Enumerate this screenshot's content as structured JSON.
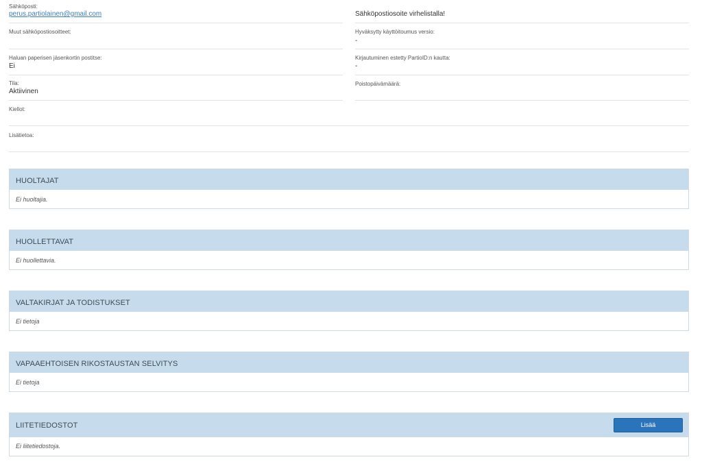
{
  "left_fields": [
    {
      "label": "Sähköposti:",
      "value": "perus.partiolainen@gmail.com"
    },
    {
      "label": "Muut sähköpostiosoitteet:",
      "value": ""
    },
    {
      "label": "Haluan paperisen jäsenkortin postitse:",
      "value": "Ei"
    },
    {
      "label": "Tila:",
      "value": "Aktiivinen"
    }
  ],
  "right_fields": [
    {
      "label": "",
      "value": "Sähköpostiosoite virhelistalla!"
    },
    {
      "label": "Hyväksytty käyttöitoumus versio:",
      "value": "-"
    },
    {
      "label": "Kirjautuminen estetty PartioID:n kautta:",
      "value": "-"
    },
    {
      "label": "Poistopäivämäärä:",
      "value": ""
    }
  ],
  "wide_fields": [
    {
      "label": "Kiellot:",
      "value": ""
    },
    {
      "label": "Lisätietoa:",
      "value": ""
    }
  ],
  "panels": {
    "guardians": {
      "title": "HUOLTAJAT",
      "empty": "Ei huoltajia."
    },
    "dependents": {
      "title": "HUOLLETTAVAT",
      "empty": "Ei huollettavia."
    },
    "certificates": {
      "title": "VALTAKIRJAT JA TODISTUKSET",
      "empty": "Ei tietoja"
    },
    "background_check": {
      "title": "VAPAAEHTOISEN RIKOSTAUSTAN SELVITYS",
      "empty": "Ei tietoja"
    },
    "attachments": {
      "title": "LIITETIEDOSTOT",
      "empty": "Ei liitetiedostoja.",
      "add_label": "Lisää"
    }
  },
  "colors": {
    "panel_header": "#c6dcec",
    "link": "#3a7fc1",
    "button": "#2b74bb"
  }
}
